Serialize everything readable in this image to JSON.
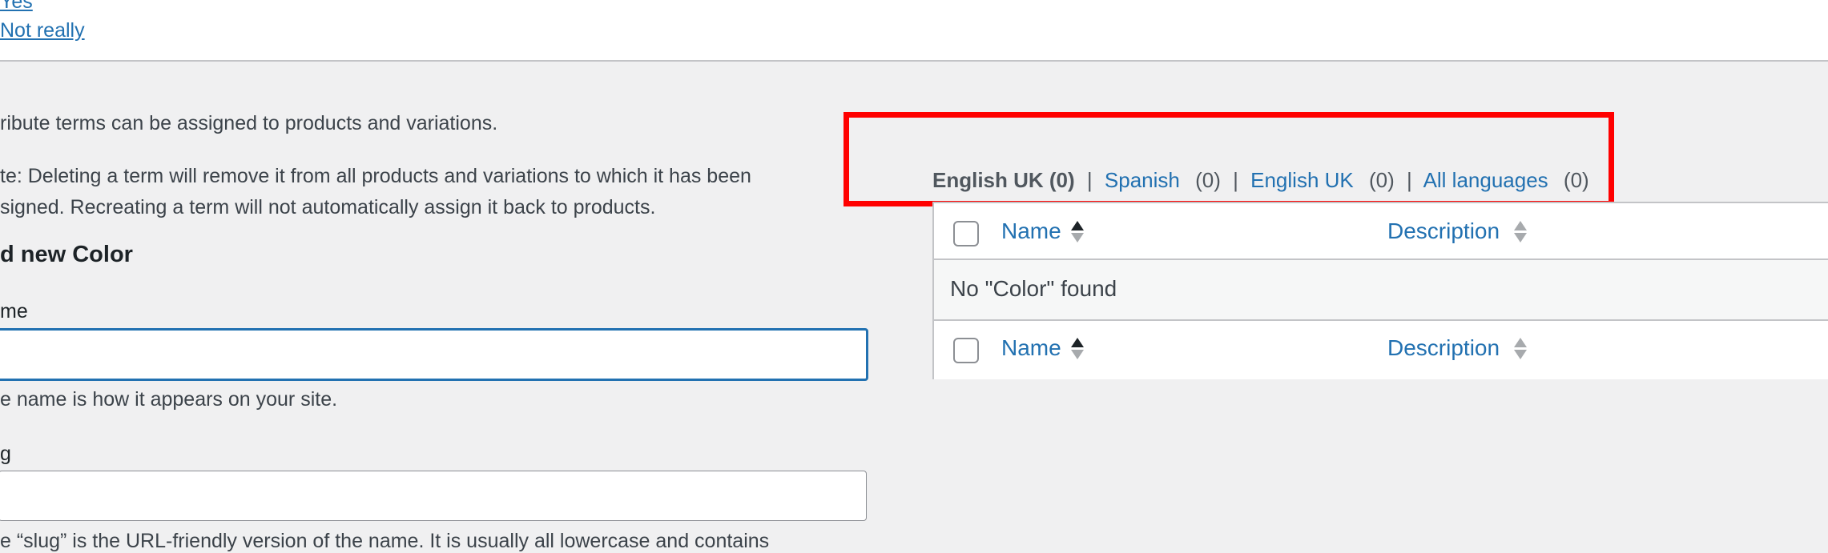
{
  "feedback": {
    "yes_label": "Yes",
    "no_label": "Not really"
  },
  "left": {
    "intro": "ribute terms can be assigned to products and variations.",
    "note_line1": "te: Deleting a term will remove it from all products and variations to which it has been",
    "note_line2": "signed. Recreating a term will not automatically assign it back to products.",
    "heading": "d new Color",
    "name_label": "me",
    "name_value": "",
    "name_hint": "e name is how it appears on your site.",
    "slug_label": "g",
    "slug_value": "",
    "slug_hint": "e “slug” is the URL-friendly version of the name. It is usually all lowercase and contains"
  },
  "languages": {
    "current_label": "English UK (0)",
    "items": [
      {
        "label": "Spanish",
        "count": "(0)"
      },
      {
        "label": "English UK",
        "count": "(0)"
      },
      {
        "label": "All languages",
        "count": "(0)"
      }
    ],
    "separator": "|"
  },
  "table": {
    "columns": [
      "Name",
      "Description"
    ],
    "empty_message": "No \"Color\" found"
  },
  "colors": {
    "link": "#2271b1",
    "highlight": "#ff0000",
    "background": "#f0f0f1"
  }
}
